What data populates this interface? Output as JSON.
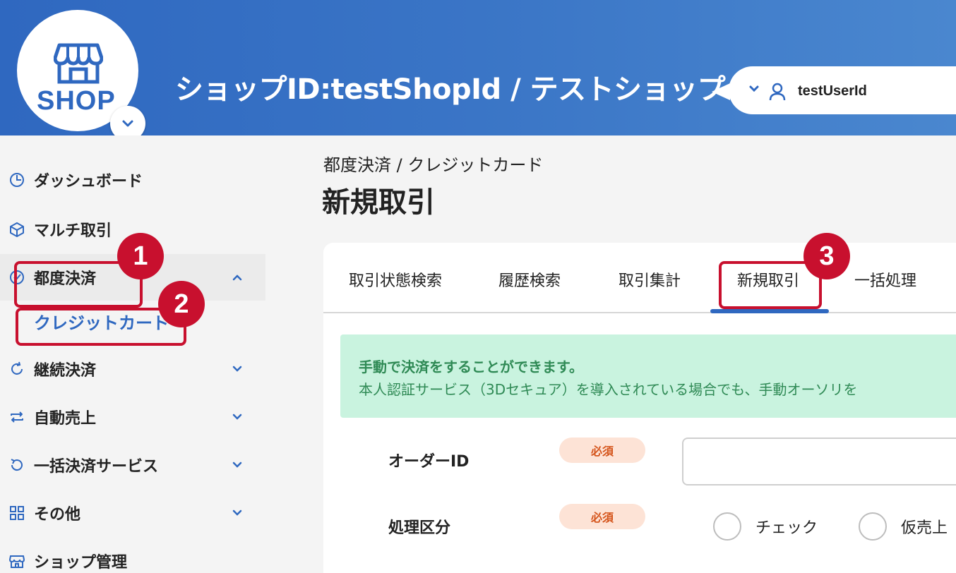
{
  "header": {
    "logo_text": "SHOP",
    "shop_title": "ショップID:testShopId / テストショップ",
    "user_name": "testUserId"
  },
  "sidebar": {
    "items": [
      {
        "label": "ダッシュボード",
        "icon": "clock-pie-icon"
      },
      {
        "label": "マルチ取引",
        "icon": "cube-icon"
      },
      {
        "label": "都度決済",
        "icon": "check-circle-icon",
        "expanded": true
      },
      {
        "label": "継続決済",
        "icon": "refresh-icon"
      },
      {
        "label": "自動売上",
        "icon": "repeat-arrows-icon"
      },
      {
        "label": "一括決済サービス",
        "icon": "rotate-left-icon"
      },
      {
        "label": "その他",
        "icon": "grid-icon"
      },
      {
        "label": "ショップ管理",
        "icon": "store-icon"
      }
    ],
    "sub_item": "クレジットカード"
  },
  "main": {
    "breadcrumb": "都度決済 / クレジットカード",
    "title": "新規取引",
    "tabs": [
      {
        "label": "取引状態検索"
      },
      {
        "label": "履歴検索"
      },
      {
        "label": "取引集計"
      },
      {
        "label": "新規取引",
        "active": true
      },
      {
        "label": "一括処理"
      }
    ],
    "info": {
      "title": "手動で決済をすることができます。",
      "text": "本人認証サービス（3Dセキュア）を導入されている場合でも、手動オーソリを"
    },
    "form": {
      "order_id_label": "オーダーID",
      "order_id_value": "",
      "required_label": "必須",
      "process_label": "処理区分",
      "options": [
        "チェック",
        "仮売上"
      ]
    }
  },
  "annotations": [
    "1",
    "2",
    "3"
  ],
  "colors": {
    "brand": "#2f68c0",
    "highlight": "#c8102e",
    "info_bg": "#c9f3df",
    "required": "#d5551c"
  }
}
